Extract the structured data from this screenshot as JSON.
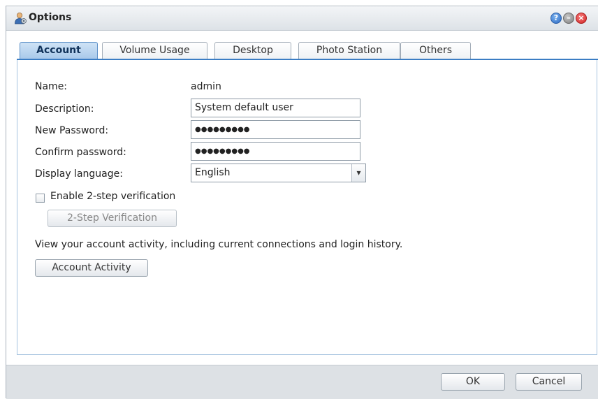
{
  "window": {
    "title": "Options",
    "icon": "user-settings-icon",
    "controls": {
      "help_label": "?",
      "minimize_label": "–",
      "close_label": "×"
    }
  },
  "tabs": [
    {
      "label": "Account",
      "active": true
    },
    {
      "label": "Volume Usage",
      "active": false
    },
    {
      "label": "Desktop",
      "active": false
    },
    {
      "label": "Photo Station",
      "active": false
    },
    {
      "label": "Others",
      "active": false
    }
  ],
  "account": {
    "name_label": "Name:",
    "name_value": "admin",
    "description_label": "Description:",
    "description_value": "System default user",
    "new_password_label": "New Password:",
    "new_password_value": "●●●●●●●●●",
    "confirm_password_label": "Confirm password:",
    "confirm_password_value": "●●●●●●●●●",
    "display_language_label": "Display language:",
    "display_language_value": "English",
    "two_step_checkbox_label": "Enable 2-step verification",
    "two_step_checked": false,
    "two_step_button": "2-Step Verification",
    "activity_text": "View your account activity, including current connections and login history.",
    "activity_button": "Account Activity"
  },
  "footer": {
    "ok_label": "OK",
    "cancel_label": "Cancel"
  },
  "colors": {
    "active_tab": "#a9c9ea",
    "tab_underline": "#3b7dc4",
    "close_button": "#d12323",
    "help_button": "#2d6ac3"
  }
}
